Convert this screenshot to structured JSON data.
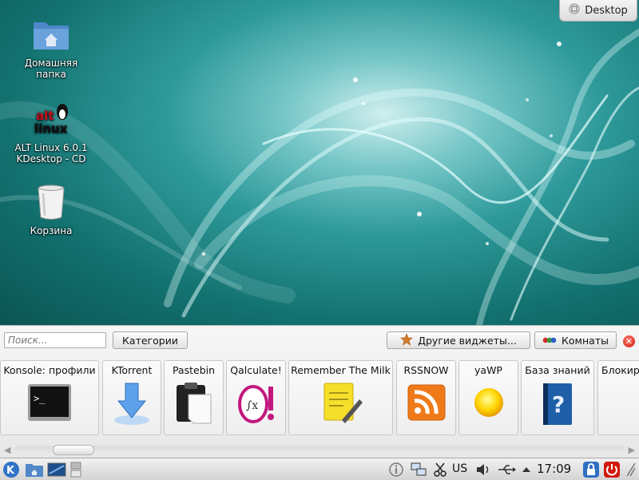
{
  "desktop": {
    "toolbox_label": "Desktop",
    "icons": [
      {
        "label": "Домашняя папка",
        "icon": "home-folder-icon"
      },
      {
        "label": "ALT Linux 6.0.1 KDesktop - CD",
        "icon": "alt-linux-icon"
      },
      {
        "label": "Корзина",
        "icon": "trash-icon"
      }
    ]
  },
  "widget_explorer": {
    "search_placeholder": "Поиск...",
    "categories_label": "Категории",
    "more_widgets_label": "Другие виджеты...",
    "activities_label": "Комнаты",
    "widgets": [
      {
        "title": "Konsole: профили",
        "icon": "terminal-icon"
      },
      {
        "title": "KTorrent",
        "icon": "download-arrow-icon"
      },
      {
        "title": "Pastebin",
        "icon": "clipboard-icon"
      },
      {
        "title": "Qalculate!",
        "icon": "calculator-icon"
      },
      {
        "title": "Remember The Milk",
        "icon": "notepad-icon"
      },
      {
        "title": "RSSNOW",
        "icon": "rss-icon"
      },
      {
        "title": "yaWP",
        "icon": "sun-icon"
      },
      {
        "title": "База знаний",
        "icon": "help-book-icon"
      },
      {
        "title": "Блокир",
        "icon": "lock-icon"
      }
    ]
  },
  "taskbar": {
    "keyboard_layout": "US",
    "clock": "17:09"
  },
  "colors": {
    "wallpaper": "#12716f",
    "accent_red": "#d2190c",
    "rss_orange": "#f07a1a"
  }
}
